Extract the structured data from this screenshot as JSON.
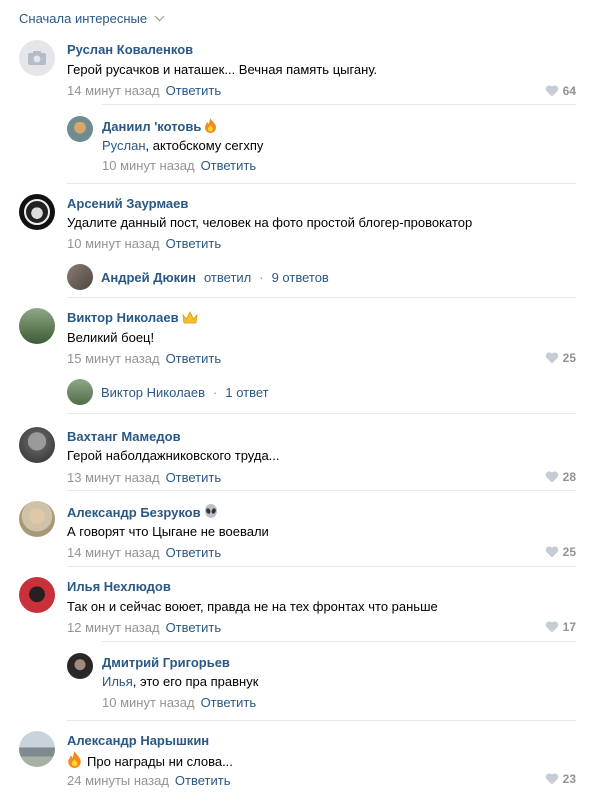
{
  "sort": {
    "label": "Сначала интересные"
  },
  "comments": [
    {
      "name": "Руслан Коваленков",
      "text": "Герой русачков и наташек... Вечная память цыгану.",
      "time": "14 минут назад",
      "reply": "Ответить",
      "likes": "64"
    },
    {
      "name": "Даниил 'котовь",
      "mention": "Руслан",
      "text": ", актобскому сегхпу",
      "time": "10 минут назад",
      "reply": "Ответить"
    },
    {
      "name": "Арсений Заурмаев",
      "text": "Удалите данный пост, человек на фото простой блогер-провокатор",
      "time": "10 минут назад",
      "reply": "Ответить"
    },
    {
      "name": "Виктор Николаев",
      "text": "Великий боец!",
      "time": "15 минут назад",
      "reply": "Ответить",
      "likes": "25"
    },
    {
      "name": "Вахтанг Мамедов",
      "text": "Герой наболдажниковского труда...",
      "time": "13 минут назад",
      "reply": "Ответить",
      "likes": "28"
    },
    {
      "name": "Александр Безруков",
      "text": "А говорят что Цыгане не воевали",
      "time": "14 минут назад",
      "reply": "Ответить",
      "likes": "25"
    },
    {
      "name": "Илья Нехлюдов",
      "text": "Так он и сейчас воюет, правда не на тех фронтах что раньше",
      "time": "12 минут назад",
      "reply": "Ответить",
      "likes": "17"
    },
    {
      "name": "Дмитрий Григорьев",
      "mention": "Илья",
      "text": ", это его пра правнук",
      "time": "10 минут назад",
      "reply": "Ответить"
    },
    {
      "name": "Александр Нарышкин",
      "text": "Про награды ни слова...",
      "time": "24 минуты назад",
      "reply": "Ответить",
      "likes": "23"
    }
  ],
  "threads": [
    {
      "name": "Андрей Дюкин",
      "action": "ответил",
      "count": "9 ответов"
    },
    {
      "name": "Виктор Николаев",
      "count": "1 ответ"
    }
  ],
  "colors": {
    "link": "#2a5885",
    "muted": "#939393",
    "separator": "#e7e8ec"
  }
}
